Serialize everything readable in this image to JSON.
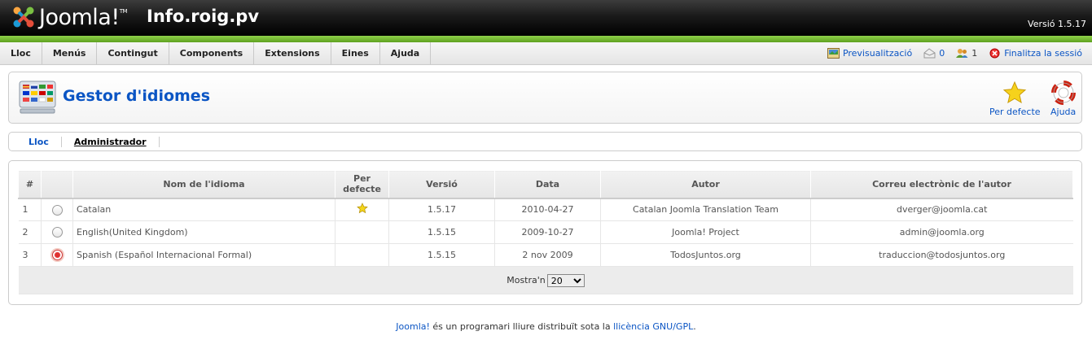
{
  "header": {
    "logo_text": "Joomla!",
    "logo_tm": "TM",
    "site_name": "Info.roig.pv",
    "version": "Versió 1.5.17"
  },
  "menu": [
    "Lloc",
    "Menús",
    "Contingut",
    "Components",
    "Extensions",
    "Eines",
    "Ajuda"
  ],
  "status": {
    "preview": "Previsualització",
    "messages": "0",
    "users": "1",
    "logout": "Finalitza la sessió"
  },
  "toolbar": {
    "title": "Gestor d'idiomes",
    "default_label": "Per defecte",
    "help_label": "Ajuda"
  },
  "submenu": [
    {
      "label": "Lloc",
      "active": false
    },
    {
      "label": "Administrador",
      "active": true
    }
  ],
  "table": {
    "headers": {
      "num": "#",
      "name": "Nom de l'idioma",
      "default": "Per defecte",
      "version": "Versió",
      "date": "Data",
      "author": "Autor",
      "email": "Correu electrònic de l'autor"
    },
    "rows": [
      {
        "num": "1",
        "name": "Catalan",
        "is_default": true,
        "checked": false,
        "version": "1.5.17",
        "date": "2010-04-27",
        "author": "Catalan Joomla Translation Team",
        "email": "dverger@joomla.cat"
      },
      {
        "num": "2",
        "name": "English(United Kingdom)",
        "is_default": false,
        "checked": false,
        "version": "1.5.15",
        "date": "2009-10-27",
        "author": "Joomla! Project",
        "email": "admin@joomla.org"
      },
      {
        "num": "3",
        "name": "Spanish (Español Internacional Formal)",
        "is_default": false,
        "checked": true,
        "version": "1.5.15",
        "date": "2 nov 2009",
        "author": "TodosJuntos.org",
        "email": "traduccion@todosjuntos.org"
      }
    ],
    "limit_label": "Mostra'n",
    "limit_value": "20"
  },
  "footer": {
    "joomla_link": "Joomla!",
    "text": " és un programari lliure distribuït sota la ",
    "license_link": "llicència GNU/GPL",
    "end": "."
  },
  "colors": {
    "link": "#0b55c4",
    "green_bar": "#6cb52a",
    "header_bg": "#000000"
  }
}
